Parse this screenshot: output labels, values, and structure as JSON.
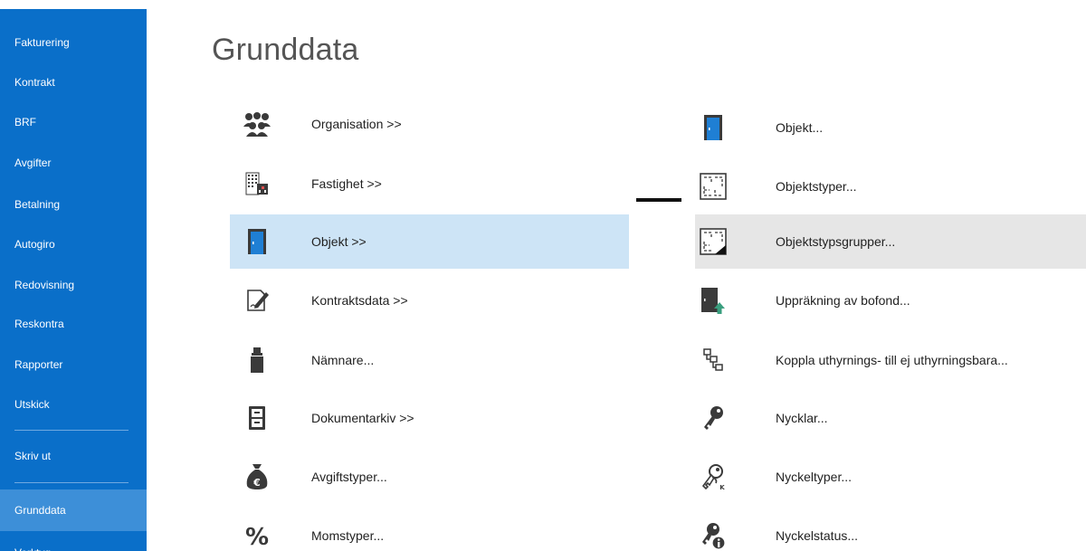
{
  "sidebar": {
    "items": [
      {
        "label": "Fakturering"
      },
      {
        "label": "Kontrakt"
      },
      {
        "label": "BRF"
      },
      {
        "label": "Avgifter"
      },
      {
        "label": "Betalning"
      },
      {
        "label": "Autogiro"
      },
      {
        "label": "Redovisning"
      },
      {
        "label": "Reskontra"
      },
      {
        "label": "Rapporter"
      },
      {
        "label": "Utskick"
      },
      {
        "label": "Skriv ut"
      },
      {
        "label": "Grunddata"
      },
      {
        "label": "Verktyg"
      }
    ],
    "active_item": "Grunddata",
    "background": "#0a6fc9",
    "active_background": "#3d8fd8"
  },
  "main": {
    "title": "Grunddata",
    "left_column": [
      {
        "label": "Organisation >>",
        "icon": "people-group-icon"
      },
      {
        "label": "Fastighet >>",
        "icon": "building-icon"
      },
      {
        "label": "Objekt >>",
        "icon": "door-icon"
      },
      {
        "label": "Kontraktsdata >>",
        "icon": "document-edit-icon"
      },
      {
        "label": "Nämnare...",
        "icon": "weight-icon"
      },
      {
        "label": "Dokumentarkiv >>",
        "icon": "file-cabinet-icon"
      },
      {
        "label": "Avgiftstyper...",
        "icon": "money-bag-euro-icon"
      },
      {
        "label": "Momstyper...",
        "icon": "percent-icon"
      }
    ],
    "right_column": [
      {
        "label": "Objekt...",
        "icon": "door-icon"
      },
      {
        "label": "Objektstyper...",
        "icon": "floorplan-icon"
      },
      {
        "label": "Objektstypsgrupper...",
        "icon": "floorplan-group-icon"
      },
      {
        "label": "Uppräkning av bofond...",
        "icon": "door-arrow-up-icon"
      },
      {
        "label": "Koppla uthyrnings- till ej uthyrningsbara...",
        "icon": "hierarchy-icon"
      },
      {
        "label": "Nycklar...",
        "icon": "key-icon"
      },
      {
        "label": "Nyckeltyper...",
        "icon": "key-type-icon"
      },
      {
        "label": "Nyckelstatus...",
        "icon": "key-info-icon"
      }
    ],
    "selected_left": "Objekt >>",
    "highlighted_right": "Objektstypsgrupper...",
    "colors": {
      "selected_blue": "#cde4f6",
      "hover_gray": "#e6e6e6",
      "icon_dark": "#3a3a3a",
      "door_blue": "#1f7fd4"
    }
  }
}
